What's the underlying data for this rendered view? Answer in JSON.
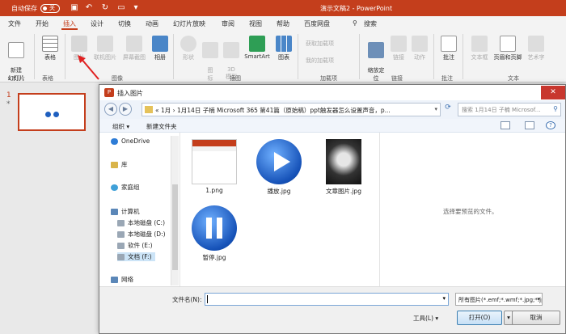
{
  "titlebar": {
    "autosave_label": "自动保存",
    "autosave_state": "关",
    "document_title": "演示文稿2 - PowerPoint",
    "accent_color": "#c43e1c"
  },
  "menu": {
    "items": [
      "文件",
      "开始",
      "插入",
      "设计",
      "切换",
      "动画",
      "幻灯片放映",
      "审阅",
      "视图",
      "帮助",
      "百度网盘",
      "搜索"
    ],
    "active": "插入"
  },
  "ribbon": {
    "buttons": {
      "new_slide": "新建\n幻灯片",
      "table": "表格",
      "picture": "图片",
      "online_picture": "联机图片",
      "screenshot": "屏幕截图",
      "album": "相册",
      "shapes": "形状",
      "icons": "图\n标",
      "model3d": "3D\n模型",
      "smartart": "SmartArt",
      "chart": "图表",
      "get_addins": "获取加载项",
      "my_addins": "我的加载项",
      "zoom": "缩放定\n位",
      "link": "链接",
      "action": "动作",
      "comment": "批注",
      "textbox": "文本框",
      "header_footer": "页眉和页脚",
      "wordart": "艺术字"
    },
    "groups": [
      "幻灯片",
      "表格",
      "图像",
      "插图",
      "加载项",
      "链接",
      "批注",
      "文本"
    ]
  },
  "slides": {
    "number": "1",
    "star": "*"
  },
  "dialog": {
    "title": "插入图片",
    "close_glyph": "✕",
    "path": "«  1月  ›  1月14日 子楠 Microsoft 365  第41篇（原始稿）ppt触发器怎么设置声音，p...",
    "search_placeholder": "搜索 1月14日 子楠 Microsof...",
    "toolbar": {
      "organize": "组织 ▾",
      "new_folder": "新建文件夹"
    },
    "nav": {
      "onedrive": "OneDrive",
      "library": "库",
      "homegroup": "家庭组",
      "computer": "计算机",
      "drive_c": "本地磁盘 (C:)",
      "drive_d": "本地磁盘 (D:)",
      "drive_e": "软件 (E:)",
      "drive_f": "文档 (F:)",
      "network": "网络"
    },
    "files": [
      {
        "name": "1.png"
      },
      {
        "name": "播放.jpg"
      },
      {
        "name": "文章图片.jpg"
      },
      {
        "name": "暂停.jpg"
      }
    ],
    "preview_text": "选择要预览的文件。",
    "filename_label": "文件名(N):",
    "filename_value": "",
    "filter_value": "所有图片(*.emf;*.wmf;*.jpg;*.jp",
    "tools_label": "工具(L)   ▾",
    "open_button": "打开(O)",
    "cancel_button": "取消"
  }
}
